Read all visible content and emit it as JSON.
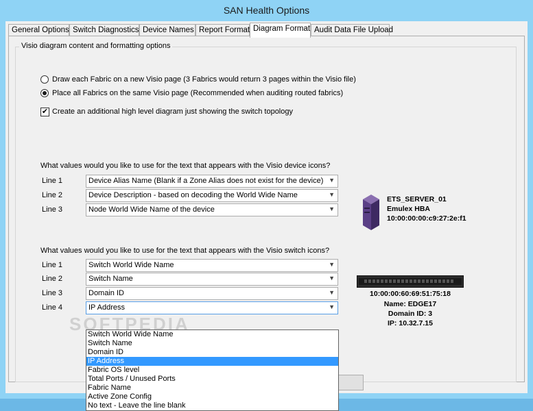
{
  "window": {
    "title": "SAN Health Options"
  },
  "tabs": [
    {
      "label": "General Options"
    },
    {
      "label": "Switch Diagnostics"
    },
    {
      "label": "Device Names"
    },
    {
      "label": "Report Format"
    },
    {
      "label": "Diagram Format"
    },
    {
      "label": "Audit Data File Upload"
    }
  ],
  "active_tab": "Diagram Format",
  "group": {
    "legend": "Visio diagram content and formatting options"
  },
  "options": {
    "radio_new_page": {
      "label": "Draw each Fabric on a new Visio page (3 Fabrics would return 3 pages within the Visio file)",
      "checked": false
    },
    "radio_same_page": {
      "label": "Place all Fabrics on the same Visio page (Recommended when auditing routed fabrics)",
      "checked": true
    },
    "check_high_level": {
      "label": "Create an additional high level diagram just showing the switch topology",
      "checked": true,
      "glyph": "✔"
    }
  },
  "device_section": {
    "question": "What values would you like to use for the text that appears with the Visio device icons?",
    "lines": [
      {
        "label": "Line 1",
        "value": "Device Alias Name (Blank if a Zone Alias does not exist for the device)"
      },
      {
        "label": "Line 2",
        "value": "Device Description - based on decoding the World Wide Name"
      },
      {
        "label": "Line 3",
        "value": "Node World Wide Name of the device"
      }
    ],
    "preview": {
      "name": "ETS_SERVER_01",
      "type": "Emulex HBA",
      "wwn": "10:00:00:00:c9:27:2e:f1"
    }
  },
  "switch_section": {
    "question": "What values would you like to use for the text that appears with the Visio switch icons?",
    "lines": [
      {
        "label": "Line 1",
        "value": "Switch World Wide Name"
      },
      {
        "label": "Line 2",
        "value": "Switch Name"
      },
      {
        "label": "Line 3",
        "value": "Domain ID"
      },
      {
        "label": "Line 4",
        "value": "IP Address"
      }
    ],
    "preview": {
      "wwn": "10:00:00:60:69:51:75:18",
      "name": "Name: EDGE17",
      "domain": "Domain ID: 3",
      "ip": "IP: 10.32.7.15"
    }
  },
  "dropdown": {
    "items": [
      "Switch World Wide Name",
      "Switch Name",
      "Domain ID",
      "IP Address",
      "Fabric OS level",
      "Total Ports / Unused Ports",
      "Fabric Name",
      "Active Zone Config",
      "No text - Leave the line blank"
    ],
    "selected_index": 3
  },
  "watermark": "SOFTPEDIA",
  "icons": {
    "dropdown_arrow": "chevron-down-icon",
    "server": "server-icon",
    "switch": "switch-icon"
  }
}
